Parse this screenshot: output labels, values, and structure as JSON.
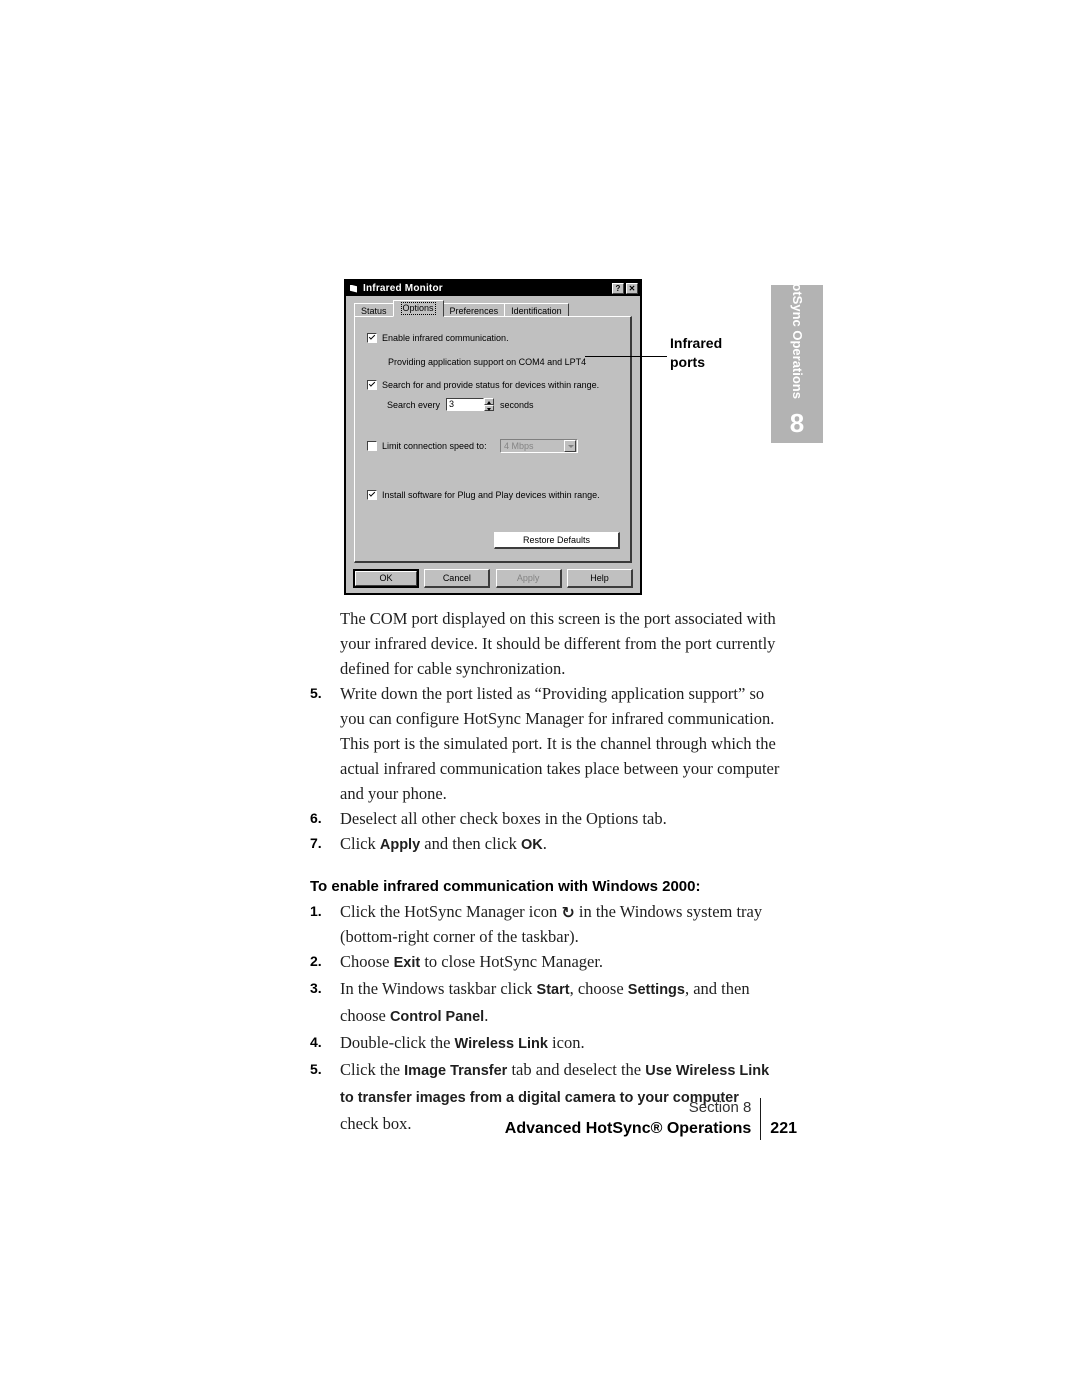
{
  "figure": {
    "dialog": {
      "title": "Infrared Monitor",
      "title_icon": "infrared-monitor-icon",
      "help_button": "?",
      "close_button": "✕",
      "tabs": [
        {
          "label": "Status",
          "selected": false
        },
        {
          "label": "Options",
          "selected": true
        },
        {
          "label": "Preferences",
          "selected": false
        },
        {
          "label": "Identification",
          "selected": false
        }
      ],
      "options": {
        "enable_infrared": {
          "label": "Enable infrared communication.",
          "checked": true
        },
        "providing_support": "Providing application support on COM4 and LPT4",
        "search_devices": {
          "label": "Search for and provide status for devices within range.",
          "checked": true
        },
        "search_every_prefix": "Search every",
        "search_every_value": "3",
        "search_every_suffix": "seconds",
        "limit_speed": {
          "label": "Limit connection speed to:",
          "checked": false
        },
        "limit_speed_value": "4 Mbps",
        "install_pnp": {
          "label": "Install software for Plug and Play devices within range.",
          "checked": true
        },
        "restore_defaults": "Restore Defaults"
      },
      "buttons": [
        {
          "label": "OK",
          "default": true,
          "disabled": false
        },
        {
          "label": "Cancel",
          "default": false,
          "disabled": false
        },
        {
          "label": "Apply",
          "default": false,
          "disabled": true
        },
        {
          "label": "Help",
          "default": false,
          "disabled": false
        }
      ]
    },
    "callout": {
      "line1": "Infrared",
      "line2": "ports"
    }
  },
  "section_tab": {
    "label": "HotSync Operations",
    "number": "8",
    "color": "#b3b3b3"
  },
  "body": {
    "p_com_port": "The COM port displayed on this screen is the port associated with your infrared device. It should be different from the port currently defined for cable synchronization.",
    "step5_num": "5.",
    "step5_text": "Write down the port listed as “Providing application support” so you can configure HotSync Manager for infrared communication.",
    "p_simulated": "This port is the simulated port. It is the channel through which the actual infrared communication takes place between your computer and your phone.",
    "step6_num": "6.",
    "step6_text": "Deselect all other check boxes in the Options tab.",
    "step7_num": "7.",
    "step7_a": "Click ",
    "step7_b": "Apply",
    "step7_c": " and then click ",
    "step7_d": "OK",
    "step7_e": ".",
    "subhead": "To enable infrared communication with Windows 2000:",
    "w1_num": "1.",
    "w1_a": "Click the HotSync Manager icon ",
    "w1_icon": "↻",
    "w1_b": " in the Windows system tray (bottom-right corner of the taskbar).",
    "w2_num": "2.",
    "w2_a": "Choose ",
    "w2_b": "Exit",
    "w2_c": " to close HotSync Manager.",
    "w3_num": "3.",
    "w3_a": "In the Windows taskbar click ",
    "w3_b": "Start",
    "w3_c": ", choose ",
    "w3_d": "Settings",
    "w3_e": ", and then choose ",
    "w3_f": "Control Panel",
    "w3_g": ".",
    "w4_num": "4.",
    "w4_a": "Double-click the ",
    "w4_b": "Wireless Link",
    "w4_c": " icon.",
    "w5_num": "5.",
    "w5_a": "Click the ",
    "w5_b": "Image Transfer",
    "w5_c": " tab and deselect the ",
    "w5_d": "Use Wireless Link to transfer images from a digital camera to your computer",
    "w5_e": " check box."
  },
  "footer": {
    "section": "Section 8",
    "title": "Advanced HotSync® Operations",
    "page": "221"
  }
}
